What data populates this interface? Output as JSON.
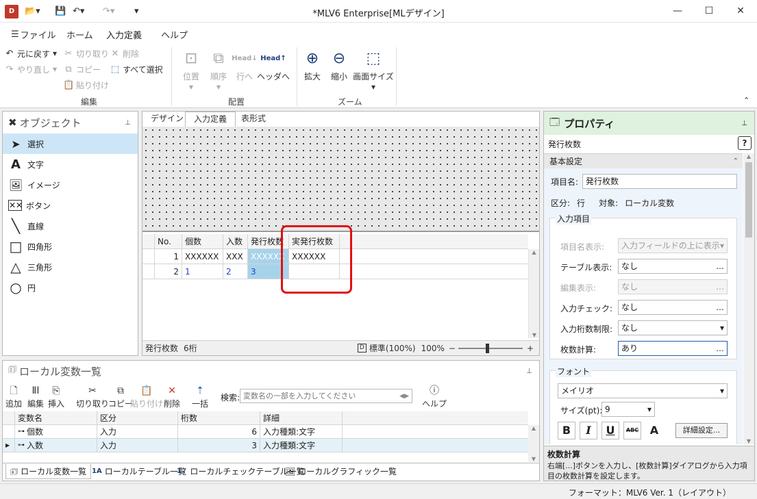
{
  "window": {
    "title": "*MLV6 Enterprise[MLデザイン]",
    "app_icon_text": "D",
    "minimize": "—",
    "maximize": "☐",
    "close": "✕"
  },
  "menu": {
    "file": "ファイル",
    "home": "ホーム",
    "input_def": "入力定義",
    "help": "ヘルプ"
  },
  "ribbon": {
    "undo": "元に戻す",
    "redo": "やり直し",
    "cut": "切り取り",
    "copy": "コピー",
    "paste": "貼り付け",
    "delete": "削除",
    "select_all": "すべて選択",
    "edit_group": "編集",
    "position": "位置",
    "order": "順序",
    "to_row": "行へ",
    "to_header": "ヘッダへ",
    "head_label": "Head",
    "layout_group": "配置",
    "zoom_in": "拡大",
    "zoom_out": "縮小",
    "screen_size": "画面サイズ",
    "zoom_group": "ズーム"
  },
  "objects": {
    "title": "オブジェクト",
    "items": {
      "select": "選択",
      "text": "文字",
      "image": "イメージ",
      "button": "ボタン",
      "line": "直線",
      "rect": "四角形",
      "triangle": "三角形",
      "circle": "円"
    },
    "text_icon": "A"
  },
  "designer": {
    "tabs": {
      "design": "デザイン",
      "input_def": "入力定義",
      "table_format": "表形式"
    },
    "table": {
      "headers": [
        "No.",
        "個数",
        "入数",
        "発行枚数",
        "実発行枚数"
      ],
      "row1": [
        "1",
        "XXXXXX",
        "XXX",
        "XXXXXX",
        "XXXXXX"
      ],
      "row2": [
        "2",
        "1",
        "2",
        "3",
        ""
      ]
    },
    "status": {
      "field": "発行枚数",
      "digits": "6桁",
      "zoom_mode": "標準(100%)",
      "zoom_pct": "100%",
      "minus": "−",
      "plus": "+"
    }
  },
  "properties": {
    "title": "プロパティ",
    "selected": "発行枚数",
    "help_btn": "?",
    "basic_section": "基本設定",
    "item_name_label": "項目名:",
    "item_name_value": "発行枚数",
    "kubun_label": "区分:",
    "kubun_value": "行",
    "target_label": "対象:",
    "target_value": "ローカル変数",
    "input_group": "入力項目",
    "rows": {
      "name_display_label": "項目名表示:",
      "name_display_value": "入力フィールドの上に表示",
      "table_display_label": "テーブル表示:",
      "table_display_value": "なし",
      "edit_display_label": "編集表示:",
      "edit_display_value": "なし",
      "input_check_label": "入力チェック:",
      "input_check_value": "なし",
      "digit_limit_label": "入力桁数制限:",
      "digit_limit_value": "なし",
      "sheet_calc_label": "枚数計算:",
      "sheet_calc_value": "あり"
    },
    "ellipsis": "…",
    "font_group": "フォント",
    "font_name": "メイリオ",
    "size_label": "サイズ(pt):",
    "size_value": "9",
    "bold": "B",
    "italic": "I",
    "underline": "U",
    "strike": "ABC",
    "color": "A",
    "detail_btn": "詳細設定...",
    "help_title": "枚数計算",
    "help_text": "右端[...]ボタンを入力し、[枚数計算]ダイアログから入力項目の枚数計算を設定します。"
  },
  "locals": {
    "title": "ローカル変数一覧",
    "tools": {
      "add": "追加",
      "edit": "編集",
      "insert": "挿入",
      "cut": "切り取り",
      "copy": "コピー",
      "paste": "貼り付け",
      "delete": "削除",
      "bulk": "一括",
      "help": "ヘルプ"
    },
    "search_label": "検索:",
    "search_placeholder": "変数名の一部を入力してください",
    "headers": [
      "変数名",
      "区分",
      "桁数",
      "詳細"
    ],
    "rows": [
      [
        "個数",
        "入力",
        "6",
        "入力種類:文字"
      ],
      [
        "入数",
        "入力",
        "3",
        "入力種類:文字"
      ]
    ],
    "bottom_tabs": {
      "local_vars": "ローカル変数一覧",
      "local_tables": "ローカルテーブル一覧",
      "local_check": "ローカルチェックテーブル一覧",
      "local_graphics": "ローカルグラフィック一覧"
    }
  },
  "status_bar": {
    "format": "フォーマット：MLV6 Ver. 1（レイアウト）"
  },
  "colors": {
    "accent": "#1e5aa8",
    "selection": "#cde6f7",
    "highlight_box": "#e01010",
    "prop_header": "#dff2df"
  }
}
